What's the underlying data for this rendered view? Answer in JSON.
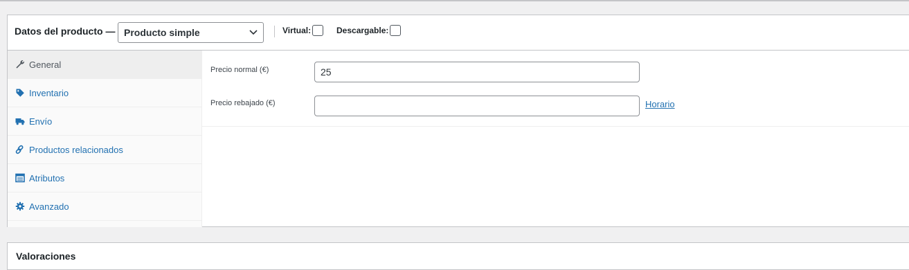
{
  "product_data": {
    "title": "Datos del producto —",
    "type_select": {
      "selected": "Producto simple"
    },
    "virtual_label": "Virtual:",
    "downloadable_label": "Descargable:"
  },
  "tabs": [
    {
      "label": "General",
      "icon": "wrench-icon",
      "active": true
    },
    {
      "label": "Inventario",
      "icon": "tag-icon"
    },
    {
      "label": "Envío",
      "icon": "truck-icon"
    },
    {
      "label": "Productos relacionados",
      "icon": "link-icon"
    },
    {
      "label": "Atributos",
      "icon": "table-icon"
    },
    {
      "label": "Avanzado",
      "icon": "gear-icon"
    }
  ],
  "general": {
    "regular_price_label": "Precio normal (€)",
    "regular_price_value": "25",
    "sale_price_label": "Precio rebajado (€)",
    "sale_price_value": "",
    "schedule_link": "Horario"
  },
  "reviews": {
    "title": "Valoraciones"
  },
  "colors": {
    "link": "#2271b1",
    "border": "#c3c4c7",
    "background": "#f0f0f1"
  }
}
